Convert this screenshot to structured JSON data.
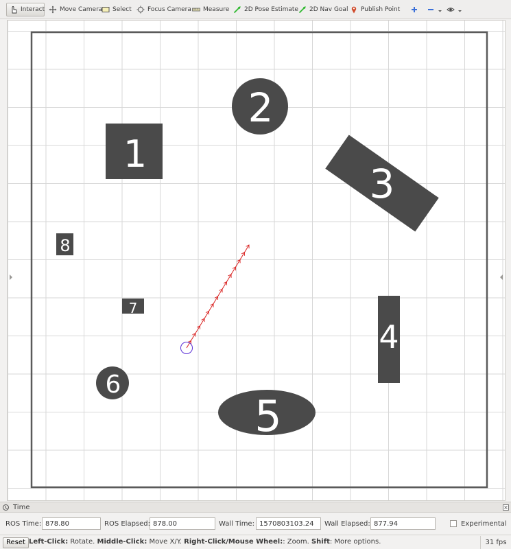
{
  "toolbar": {
    "tools": [
      {
        "label": "Interact",
        "icon": "cursor-hand-icon"
      },
      {
        "label": "Move Camera",
        "icon": "move-camera-icon"
      },
      {
        "label": "Select",
        "icon": "select-rectangle-icon"
      },
      {
        "label": "Focus Camera",
        "icon": "focus-camera-icon"
      },
      {
        "label": "Measure",
        "icon": "ruler-icon"
      },
      {
        "label": "2D Pose Estimate",
        "icon": "green-arrow-icon"
      },
      {
        "label": "2D Nav Goal",
        "icon": "green-arrow-icon"
      },
      {
        "label": "Publish Point",
        "icon": "map-pin-icon"
      }
    ],
    "active_tool": "Interact",
    "extra_icons": [
      "add-tool-icon",
      "remove-tool-icon",
      "view-options-icon"
    ]
  },
  "map": {
    "landmarks": [
      {
        "id": "1",
        "label": "1",
        "shape": "rectangle"
      },
      {
        "id": "2",
        "label": "2",
        "shape": "circle"
      },
      {
        "id": "3",
        "label": "3",
        "shape": "rotated-rectangle"
      },
      {
        "id": "4",
        "label": "4",
        "shape": "rectangle"
      },
      {
        "id": "5",
        "label": "5",
        "shape": "ellipse"
      },
      {
        "id": "6",
        "label": "6",
        "shape": "circle"
      },
      {
        "id": "7",
        "label": "7",
        "shape": "rectangle"
      },
      {
        "id": "8",
        "label": "8",
        "shape": "rectangle"
      }
    ],
    "obstacle_color": "#4a4a4a",
    "path_color": "#d9201f",
    "robot_marker_color": "#5a2fd6",
    "grid_color": "#d7d7d7"
  },
  "time_panel": {
    "title": "Time",
    "ros_time_label": "ROS Time:",
    "ros_time": "878.80",
    "ros_elapsed_label": "ROS Elapsed:",
    "ros_elapsed": "878.00",
    "wall_time_label": "Wall Time:",
    "wall_time": "1570803103.24",
    "wall_elapsed_label": "Wall Elapsed:",
    "wall_elapsed": "877.94",
    "experimental_label": "Experimental",
    "experimental_checked": false
  },
  "status": {
    "reset_label": "Reset",
    "hint_parts": [
      {
        "text": "Left-Click:",
        "bold": true
      },
      {
        "text": " Rotate. ",
        "bold": false
      },
      {
        "text": "Middle-Click:",
        "bold": true
      },
      {
        "text": " Move X/Y. ",
        "bold": false
      },
      {
        "text": "Right-Click/Mouse Wheel:",
        "bold": true
      },
      {
        "text": ": Zoom. ",
        "bold": false
      },
      {
        "text": "Shift",
        "bold": true
      },
      {
        "text": ": More options.",
        "bold": false
      }
    ],
    "fps": "31 fps"
  }
}
